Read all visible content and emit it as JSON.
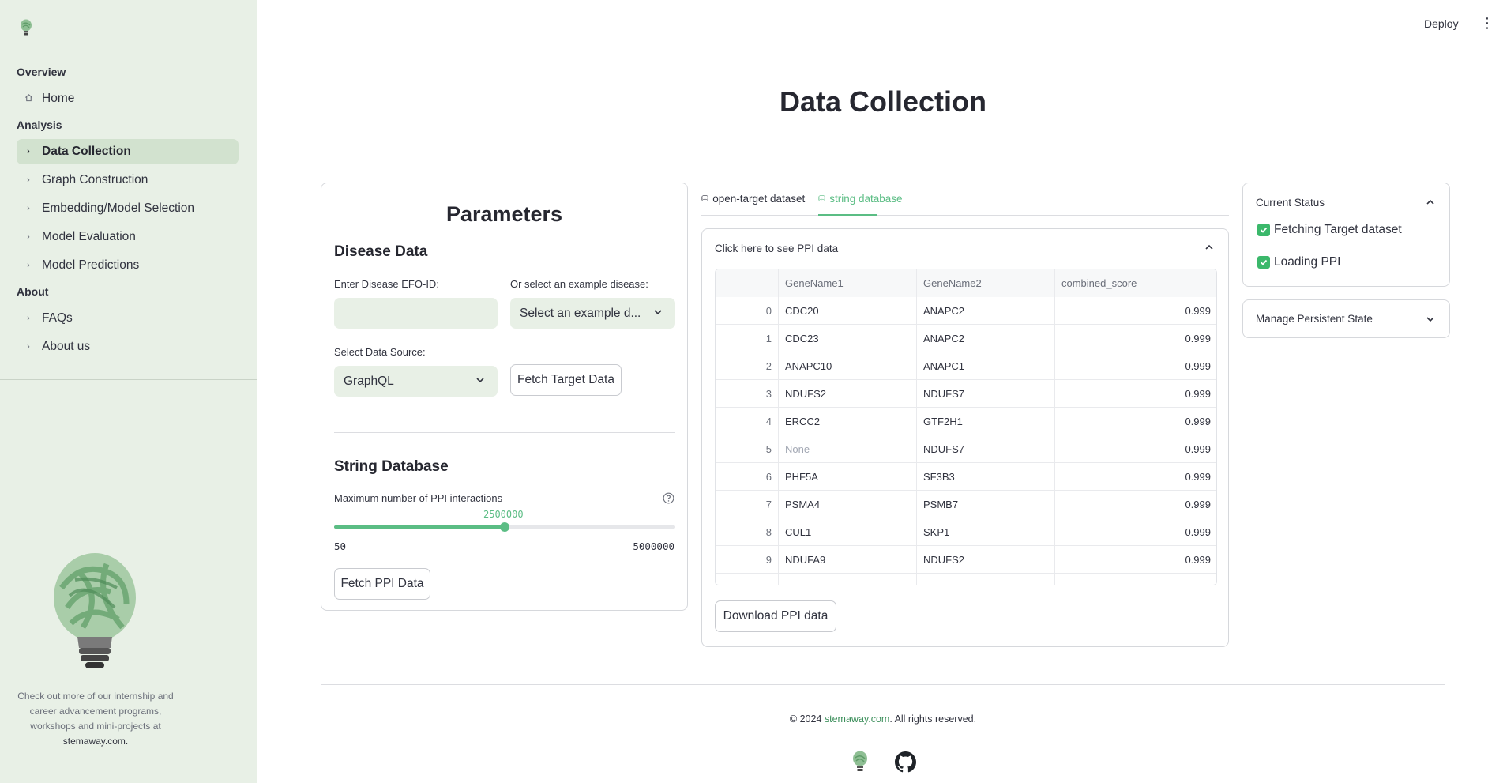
{
  "sidebar": {
    "sections": [
      {
        "title": "Overview",
        "items": [
          {
            "label": "Home",
            "icon": "home-icon"
          }
        ]
      },
      {
        "title": "Analysis",
        "items": [
          {
            "label": "Data Collection",
            "icon": "chevron-right-icon",
            "active": true
          },
          {
            "label": "Graph Construction",
            "icon": "chevron-right-icon"
          },
          {
            "label": "Embedding/Model Selection",
            "icon": "chevron-right-icon"
          },
          {
            "label": "Model Evaluation",
            "icon": "chevron-right-icon"
          },
          {
            "label": "Model Predictions",
            "icon": "chevron-right-icon"
          }
        ]
      },
      {
        "title": "About",
        "items": [
          {
            "label": "FAQs",
            "icon": "chevron-right-icon"
          },
          {
            "label": "About us",
            "icon": "chevron-right-icon"
          }
        ]
      }
    ],
    "footer_text": "Check out more of our internship and career advancement programs, workshops and mini-projects at",
    "footer_link": "stemaway.com."
  },
  "header": {
    "deploy_label": "Deploy",
    "menu_icon": "kebab-menu-icon"
  },
  "page": {
    "title": "Data Collection"
  },
  "parameters": {
    "title": "Parameters",
    "disease_heading": "Disease Data",
    "efo_label": "Enter Disease EFO-ID:",
    "efo_value": "",
    "example_label": "Or select an example disease:",
    "example_placeholder": "Select an example d...",
    "source_label": "Select Data Source:",
    "source_value": "GraphQL",
    "fetch_target_label": "Fetch Target Data",
    "string_heading": "String Database",
    "ppi_slider_label": "Maximum number of PPI interactions",
    "ppi_slider_value": "2500000",
    "ppi_slider_min": "50",
    "ppi_slider_max": "5000000",
    "ppi_slider_fraction": 0.5,
    "fetch_ppi_label": "Fetch PPI Data"
  },
  "tabs": [
    {
      "label": "open-target dataset",
      "icon": "database-icon",
      "active": false
    },
    {
      "label": "string database",
      "icon": "database-icon",
      "active": true
    }
  ],
  "ppi_panel": {
    "expander_label": "Click here to see PPI data",
    "columns": [
      "",
      "GeneName1",
      "GeneName2",
      "combined_score"
    ],
    "rows": [
      [
        "0",
        "CDC20",
        "ANAPC2",
        "0.999"
      ],
      [
        "1",
        "CDC23",
        "ANAPC2",
        "0.999"
      ],
      [
        "2",
        "ANAPC10",
        "ANAPC1",
        "0.999"
      ],
      [
        "3",
        "NDUFS2",
        "NDUFS7",
        "0.999"
      ],
      [
        "4",
        "ERCC2",
        "GTF2H1",
        "0.999"
      ],
      [
        "5",
        "None",
        "NDUFS7",
        "0.999"
      ],
      [
        "6",
        "PHF5A",
        "SF3B3",
        "0.999"
      ],
      [
        "7",
        "PSMA4",
        "PSMB7",
        "0.999"
      ],
      [
        "8",
        "CUL1",
        "SKP1",
        "0.999"
      ],
      [
        "9",
        "NDUFA9",
        "NDUFS2",
        "0.999"
      ]
    ],
    "download_label": "Download PPI data"
  },
  "status": {
    "title": "Current Status",
    "items": [
      "Fetching Target dataset",
      "Loading PPI"
    ],
    "manage_label": "Manage Persistent State"
  },
  "footer": {
    "copyright_prefix": "© 2024 ",
    "copyright_link": "stemaway.com",
    "copyright_suffix": ". All rights reserved."
  },
  "colors": {
    "accent": "#5bbd84",
    "sidebar_bg": "#e8f0e6",
    "check": "#3bb86b"
  }
}
